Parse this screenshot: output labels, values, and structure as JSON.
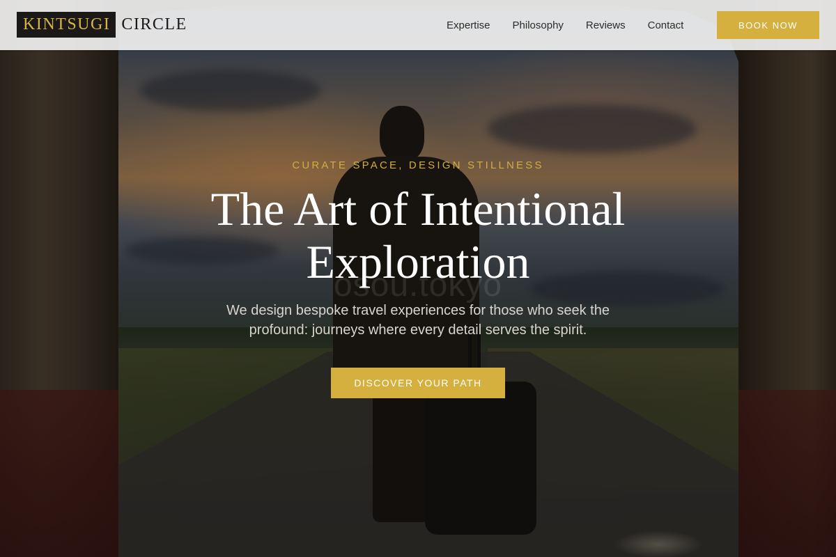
{
  "header": {
    "logo_box_text": "KINTSUGI",
    "logo_word": "CIRCLE",
    "nav": [
      {
        "label": "Expertise"
      },
      {
        "label": "Philosophy"
      },
      {
        "label": "Reviews"
      },
      {
        "label": "Contact"
      }
    ],
    "book_button": "BOOK NOW"
  },
  "hero": {
    "eyebrow": "CURATE SPACE, DESIGN STILLNESS",
    "headline": "The Art of Intentional Exploration",
    "watermark": "osou.tokyo",
    "subtext": "We design bespoke travel experiences for those who seek the profound: journeys where every detail serves the spirit.",
    "cta_button": "DISCOVER YOUR PATH"
  },
  "colors": {
    "accent_gold": "#d5b03e",
    "logo_box_bg": "#1b1917",
    "header_bg": "#f5f5f5"
  }
}
